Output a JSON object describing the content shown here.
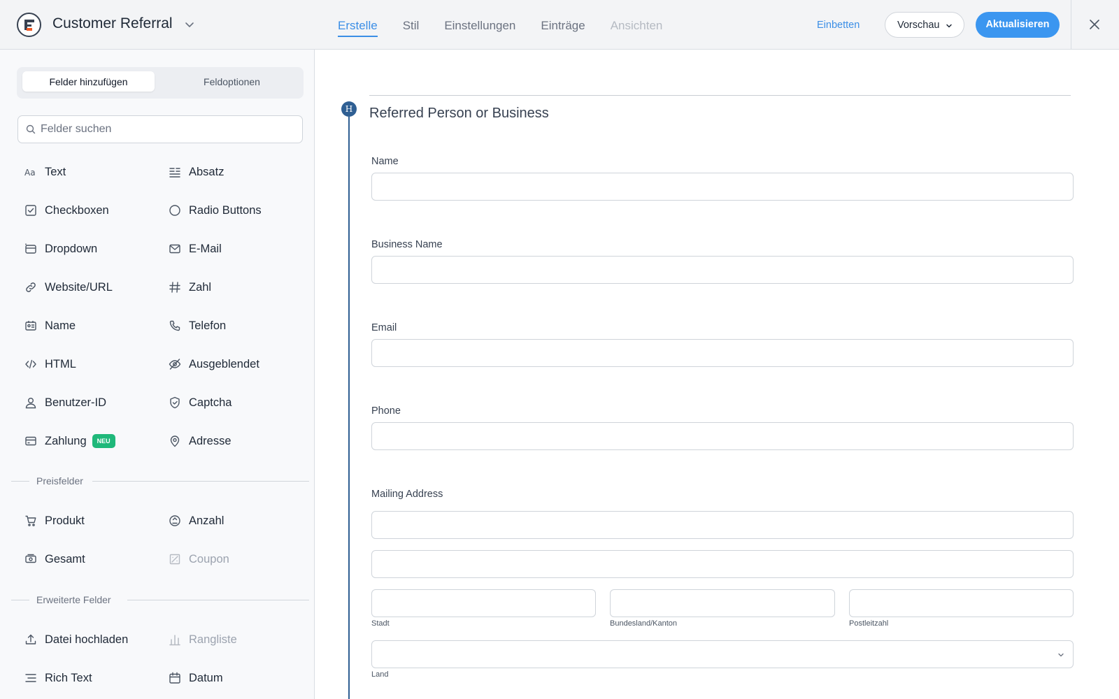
{
  "header": {
    "title": "Customer Referral",
    "tabs": [
      {
        "label": "Erstelle",
        "state": "active"
      },
      {
        "label": "Stil",
        "state": "normal"
      },
      {
        "label": "Einstellungen",
        "state": "normal"
      },
      {
        "label": "Einträge",
        "state": "normal"
      },
      {
        "label": "Ansichten",
        "state": "disabled"
      }
    ],
    "embed_label": "Einbetten",
    "preview_label": "Vorschau",
    "update_label": "Aktualisieren"
  },
  "sidebar": {
    "tab_add": "Felder hinzufügen",
    "tab_options": "Feldoptionen",
    "search_placeholder": "Felder suchen",
    "fields": [
      {
        "label": "Text",
        "icon": "text-icon"
      },
      {
        "label": "Absatz",
        "icon": "paragraph-icon"
      },
      {
        "label": "Checkboxen",
        "icon": "checkbox-icon"
      },
      {
        "label": "Radio Buttons",
        "icon": "radio-icon"
      },
      {
        "label": "Dropdown",
        "icon": "dropdown-icon"
      },
      {
        "label": "E-Mail",
        "icon": "mail-icon"
      },
      {
        "label": "Website/URL",
        "icon": "link-icon"
      },
      {
        "label": "Zahl",
        "icon": "hash-icon"
      },
      {
        "label": "Name",
        "icon": "id-card-icon"
      },
      {
        "label": "Telefon",
        "icon": "phone-icon"
      },
      {
        "label": "HTML",
        "icon": "code-icon"
      },
      {
        "label": "Ausgeblendet",
        "icon": "eye-off-icon"
      },
      {
        "label": "Benutzer-ID",
        "icon": "user-icon"
      },
      {
        "label": "Captcha",
        "icon": "shield-icon"
      },
      {
        "label": "Zahlung",
        "icon": "credit-card-icon",
        "badge": "NEU"
      },
      {
        "label": "Adresse",
        "icon": "map-pin-icon"
      }
    ],
    "price_section": "Preisfelder",
    "price_fields": [
      {
        "label": "Produkt",
        "icon": "cart-icon"
      },
      {
        "label": "Anzahl",
        "icon": "quantity-icon"
      },
      {
        "label": "Gesamt",
        "icon": "money-icon"
      },
      {
        "label": "Coupon",
        "icon": "coupon-icon",
        "disabled": true
      }
    ],
    "advanced_section": "Erweiterte Felder",
    "advanced_fields": [
      {
        "label": "Datei hochladen",
        "icon": "upload-icon"
      },
      {
        "label": "Rangliste",
        "icon": "bar-chart-icon",
        "disabled": true
      },
      {
        "label": "Rich Text",
        "icon": "rich-text-icon"
      },
      {
        "label": "Datum",
        "icon": "calendar-icon"
      }
    ]
  },
  "form": {
    "section_badge": "H",
    "section_title": "Referred Person or Business",
    "fields": {
      "name": "Name",
      "business": "Business Name",
      "email": "Email",
      "phone": "Phone",
      "address": "Mailing Address"
    },
    "address_sub": {
      "city": "Stadt",
      "state": "Bundesland/Kanton",
      "zip": "Postleitzahl",
      "country": "Land"
    }
  },
  "colors": {
    "accent": "#3b8ee6",
    "primary_button": "#3b96f0",
    "section_line": "#2f5f93",
    "badge_new": "#1fb87a"
  }
}
